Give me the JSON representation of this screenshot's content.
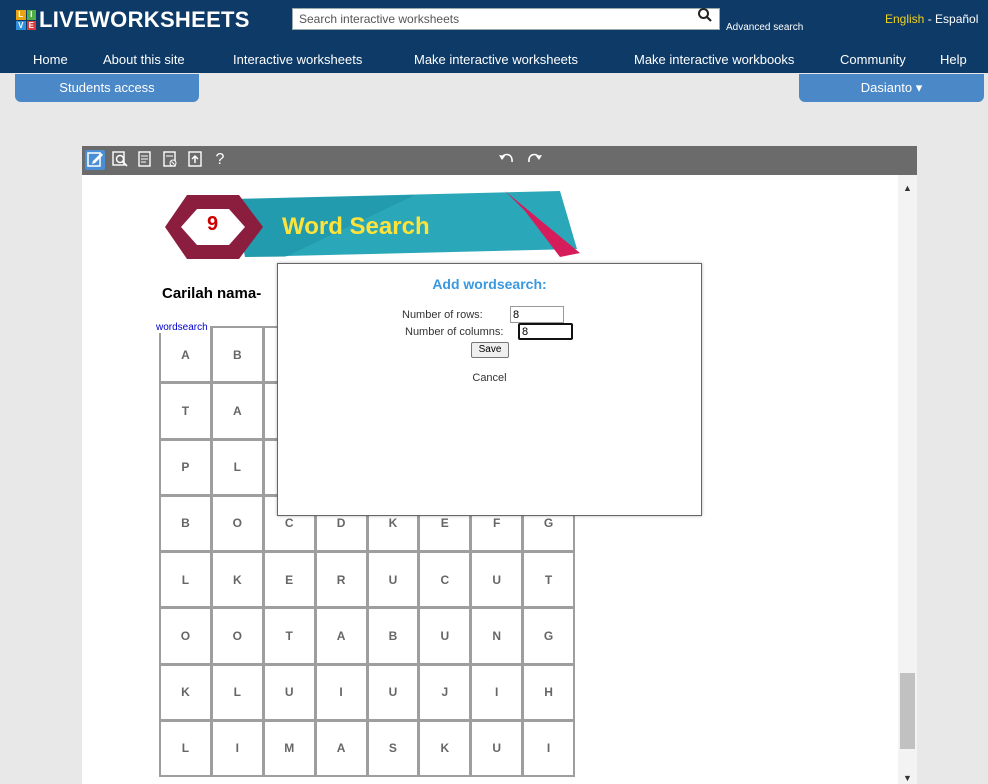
{
  "header": {
    "logo_text": "LIVEWORKSHEETS",
    "logo_letters": [
      "L",
      "I",
      "V",
      "E"
    ],
    "search_placeholder": "Search interactive worksheets",
    "advanced_search": "Advanced search",
    "lang_english": "English",
    "lang_sep": " - ",
    "lang_espanol": "Español"
  },
  "nav": {
    "items": [
      "Home",
      "About this site",
      "Interactive worksheets",
      "Make interactive worksheets",
      "Make interactive workbooks",
      "Community",
      "Help"
    ]
  },
  "sub": {
    "students": "Students access",
    "user": "Dasianto",
    "user_caret": "▾"
  },
  "toolbar": {
    "help": "?"
  },
  "worksheet": {
    "banner_number": "9",
    "banner_title": "Word Search",
    "instruction": "Carilah nama-",
    "wordsearch_label": "wordsearch",
    "grid": [
      [
        "A",
        "B",
        "",
        "",
        "",
        "",
        "",
        ""
      ],
      [
        "T",
        "A",
        "",
        "",
        "",
        "",
        "",
        ""
      ],
      [
        "P",
        "L",
        "",
        "",
        "",
        "",
        "",
        ""
      ],
      [
        "B",
        "O",
        "C",
        "D",
        "K",
        "E",
        "F",
        "G"
      ],
      [
        "L",
        "K",
        "E",
        "R",
        "U",
        "C",
        "U",
        "T"
      ],
      [
        "O",
        "O",
        "T",
        "A",
        "B",
        "U",
        "N",
        "G"
      ],
      [
        "K",
        "L",
        "U",
        "I",
        "U",
        "J",
        "I",
        "H"
      ],
      [
        "L",
        "I",
        "M",
        "A",
        "S",
        "K",
        "U",
        "I"
      ]
    ]
  },
  "dialog": {
    "title": "Add wordsearch:",
    "rows_label": "Number of rows:",
    "rows_value": "8",
    "cols_label": "Number of columns:",
    "cols_value": "8",
    "save": "Save",
    "cancel": "Cancel"
  },
  "colors": {
    "header_bg": "#0d3a66",
    "tab_bg": "#4a88c7",
    "dialog_title": "#3a98e0"
  }
}
